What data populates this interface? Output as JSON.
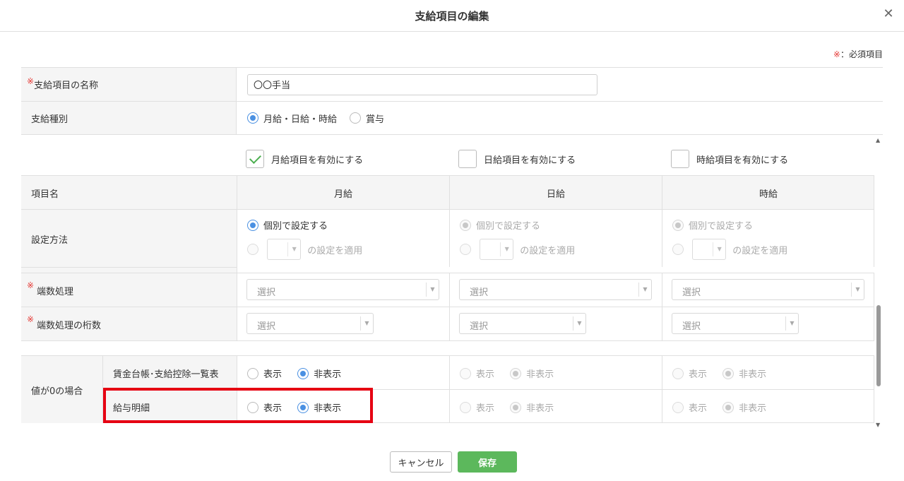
{
  "dialog": {
    "title": "支給項目の編集",
    "close_glyph": "✕"
  },
  "required_note": {
    "mark": "※",
    "text": "：必須項目"
  },
  "fields": {
    "name_label": "支給項目の名称",
    "name_value": "〇〇手当",
    "type_label": "支給種別",
    "type_options": [
      "月給・日給・時給",
      "賞与"
    ],
    "type_selected": "月給・日給・時給"
  },
  "enable_checks": [
    {
      "label": "月給項目を有効にする",
      "checked": true
    },
    {
      "label": "日給項目を有効にする",
      "checked": false
    },
    {
      "label": "時給項目を有効にする",
      "checked": false
    }
  ],
  "table": {
    "item_name_header": "項目名",
    "columns": [
      "月給",
      "日給",
      "時給"
    ],
    "setting_method_label": "設定方法",
    "setting_individual": "個別で設定する",
    "setting_apply": "の設定を適用",
    "rounding_label": "端数処理",
    "rounding_digits_label": "端数処理の桁数",
    "select_placeholder": "選択",
    "zero_label": "値が0の場合",
    "ledger_label": "賃金台帳･支給控除一覧表",
    "payslip_label": "給与明細",
    "show": "表示",
    "hide": "非表示"
  },
  "footer": {
    "cancel": "キャンセル",
    "save": "保存"
  },
  "colors": {
    "accent": "#4a90e2",
    "save_green": "#5cb85c",
    "required_red": "#e53935",
    "highlight_red": "#e60012"
  }
}
